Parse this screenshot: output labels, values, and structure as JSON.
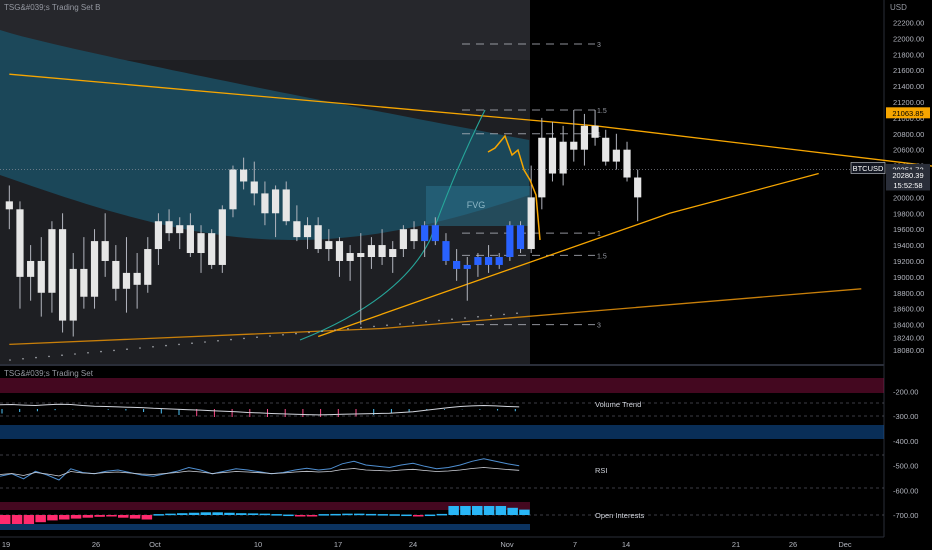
{
  "header": {
    "main_indicator": "TSG&#039;s Trading Set B",
    "sub_indicator": "TSG&#039;s Trading Set",
    "currency": "USD"
  },
  "chart_data": [
    {
      "type": "candlestick",
      "title": "",
      "ylim": [
        18000,
        22500
      ],
      "y_ticks": [
        18080,
        18240,
        18400,
        18600,
        18800,
        19000,
        19200,
        19400,
        19600,
        19800,
        20000,
        20200,
        20400,
        20600,
        20800,
        21000,
        21200,
        21400,
        21600,
        21800,
        22000,
        22200
      ],
      "y_tick_labels": [
        "18080.00",
        "18240.00",
        "18400.00",
        "18600.00",
        "18800.00",
        "19000.00",
        "19200.00",
        "19400.00",
        "19600.00",
        "19800.00",
        "20000.00",
        "20200.00",
        "20400.00",
        "20600.00",
        "20800.00",
        "21000.00",
        "21200.00",
        "21400.00",
        "21600.00",
        "21800.00",
        "22000.00",
        "22200.00"
      ],
      "x_labels": [
        "19",
        "26",
        "Oct",
        "10",
        "17",
        "24",
        "Nov",
        "7",
        "14",
        "21",
        "26",
        "Dec"
      ],
      "grid": false,
      "price_tags": [
        {
          "text": "21063.85",
          "value": 21063.85,
          "color": "#f7a600"
        },
        {
          "text": "BTCUSD",
          "value": 20351.72,
          "color": "#ffffff"
        },
        {
          "text": "20351.72",
          "value": 20351.72,
          "color": "#ffffff"
        },
        {
          "text": "20280.39",
          "value": 20280.39,
          "color": "#ffffff"
        },
        {
          "text": "15:52:58",
          "value": 20200,
          "color": "#ffffff"
        }
      ],
      "level_labels": [
        {
          "text": "3",
          "value": 21930
        },
        {
          "text": "1.5",
          "value": 21100
        },
        {
          "text": "1",
          "value": 20800
        },
        {
          "text": "1",
          "value": 19550
        },
        {
          "text": "1.5",
          "value": 19270
        },
        {
          "text": "3",
          "value": 18400
        }
      ],
      "annotations": [
        "FVG"
      ],
      "candles": [
        [
          19950,
          20150,
          19600,
          19850
        ],
        [
          19850,
          19950,
          18600,
          19000
        ],
        [
          19000,
          19400,
          18700,
          19200
        ],
        [
          19200,
          19500,
          18500,
          18800
        ],
        [
          18800,
          19700,
          18550,
          19600
        ],
        [
          19600,
          19800,
          18300,
          18450
        ],
        [
          18450,
          19300,
          18250,
          19100
        ],
        [
          19100,
          19500,
          18600,
          18750
        ],
        [
          18750,
          19600,
          18600,
          19450
        ],
        [
          19450,
          19800,
          19000,
          19200
        ],
        [
          19200,
          19400,
          18700,
          18850
        ],
        [
          18850,
          19500,
          18550,
          19050
        ],
        [
          19050,
          19300,
          18600,
          18900
        ],
        [
          18900,
          19500,
          18800,
          19350
        ],
        [
          19350,
          19800,
          19150,
          19700
        ],
        [
          19700,
          19850,
          19450,
          19550
        ],
        [
          19550,
          19750,
          19350,
          19650
        ],
        [
          19650,
          19800,
          19250,
          19300
        ],
        [
          19300,
          19650,
          19050,
          19550
        ],
        [
          19550,
          19600,
          19100,
          19150
        ],
        [
          19150,
          19900,
          19050,
          19850
        ],
        [
          19850,
          20400,
          19750,
          20350
        ],
        [
          20350,
          20500,
          20100,
          20200
        ],
        [
          20200,
          20450,
          19900,
          20050
        ],
        [
          20050,
          20200,
          19650,
          19800
        ],
        [
          19800,
          20150,
          19500,
          20100
        ],
        [
          20100,
          20200,
          19650,
          19700
        ],
        [
          19700,
          19900,
          19450,
          19500
        ],
        [
          19500,
          19750,
          19350,
          19650
        ],
        [
          19650,
          19750,
          19300,
          19350
        ],
        [
          19350,
          19600,
          19200,
          19450
        ],
        [
          19450,
          19500,
          19000,
          19200
        ],
        [
          19200,
          19400,
          18950,
          19300
        ],
        [
          19300,
          19550,
          18400,
          19250
        ],
        [
          19250,
          19500,
          19100,
          19400
        ],
        [
          19400,
          19600,
          19150,
          19250
        ],
        [
          19250,
          19450,
          19050,
          19350
        ],
        [
          19350,
          19650,
          19250,
          19600
        ],
        [
          19600,
          19700,
          19350,
          19450
        ],
        [
          19450,
          19700,
          19250,
          19650
        ],
        [
          19650,
          19750,
          19400,
          19450
        ],
        [
          19450,
          19550,
          19150,
          19200
        ],
        [
          19200,
          19350,
          18950,
          19100
        ],
        [
          19100,
          19250,
          18700,
          19150
        ],
        [
          19150,
          19300,
          19000,
          19250
        ],
        [
          19250,
          19400,
          19050,
          19150
        ],
        [
          19150,
          19300,
          19100,
          19250
        ],
        [
          19250,
          19700,
          19200,
          19650
        ],
        [
          19650,
          19700,
          19300,
          19350
        ],
        [
          19350,
          20400,
          19300,
          20000
        ],
        [
          20000,
          21000,
          19850,
          20750
        ],
        [
          20750,
          20950,
          20200,
          20300
        ],
        [
          20300,
          20900,
          20150,
          20700
        ],
        [
          20700,
          21100,
          20450,
          20600
        ],
        [
          20600,
          21050,
          20400,
          20900
        ],
        [
          20900,
          21100,
          20650,
          20750
        ],
        [
          20750,
          20850,
          20400,
          20450
        ],
        [
          20450,
          20800,
          20350,
          20600
        ],
        [
          20600,
          20700,
          20200,
          20250
        ],
        [
          20250,
          20350,
          19700,
          20000
        ]
      ],
      "candle_colors": {
        "up": "#e6e6e6",
        "down": "#2962ff",
        "wick": "#b2b5be"
      },
      "down_candle_indices": [
        39,
        40,
        41,
        42,
        43,
        44,
        45,
        46,
        47,
        48
      ],
      "trendlines": [
        {
          "name": "descending-resistance",
          "color": "#f7a600",
          "points": [
            [
              0,
              21550
            ],
            [
              55,
              20900
            ],
            [
              110,
              20020
            ]
          ]
        },
        {
          "name": "ascending-support",
          "color": "#f7a600",
          "points": [
            [
              29,
              18250
            ],
            [
              62,
              19800
            ],
            [
              76,
              20300
            ]
          ]
        },
        {
          "name": "lower-curve",
          "color": "#c87f0a",
          "points": [
            [
              0,
              18150
            ],
            [
              35,
              18350
            ],
            [
              80,
              18850
            ]
          ]
        }
      ]
    },
    {
      "type": "indicator_panel",
      "y_ticks": [
        -200,
        -300,
        -400,
        -500,
        -600,
        -700
      ],
      "y_tick_labels": [
        "-200.00",
        "-300.00",
        "-400.00",
        "-500.00",
        "-600.00",
        "-700.00"
      ],
      "series": [
        {
          "name": "Volume Trend",
          "values": [
            -250,
            -248,
            -252,
            -255,
            -250,
            -246,
            -248,
            -255,
            -260,
            -262,
            -265,
            -268,
            -270,
            -275,
            -278,
            -282,
            -285,
            -288,
            -292,
            -296,
            -300,
            -305,
            -308,
            -312,
            -315,
            -318,
            -320,
            -322,
            -320,
            -318,
            -316,
            -314,
            -312,
            -310,
            -305,
            -300,
            -290,
            -280,
            -270,
            -262,
            -258,
            -255,
            -258,
            -262,
            -265
          ],
          "bar_values": [
            -280,
            -270,
            -265,
            -258,
            -252,
            -250,
            -255,
            -260,
            -270,
            -280,
            -290,
            -298,
            -305,
            -310,
            -315,
            -318,
            -320,
            -318,
            -315,
            -310,
            -300,
            -290,
            -280,
            -268,
            -260,
            -255,
            -252,
            -255,
            -260,
            -265
          ]
        },
        {
          "name": "RSI",
          "values": [
            -530,
            -520,
            -540,
            -510,
            -525,
            -545,
            -500,
            -515,
            -520,
            -510,
            -505,
            -515,
            -525,
            -530,
            -520,
            -510,
            -495,
            -505,
            -520,
            -510,
            -500,
            -505,
            -512,
            -520,
            -515,
            -505,
            -498,
            -505,
            -500,
            -480,
            -470,
            -485,
            -490,
            -495,
            -485,
            -478,
            -490,
            -500,
            -495,
            -485,
            -470,
            -460,
            -470,
            -480,
            -488
          ]
        },
        {
          "name": "Open Interests",
          "values": [
            -1,
            -1,
            -1,
            -0.8,
            -0.6,
            -0.5,
            -0.4,
            -0.3,
            -0.2,
            -0.15,
            -0.3,
            -0.4,
            -0.5,
            0.1,
            0.15,
            0.2,
            0.25,
            0.3,
            0.3,
            0.25,
            0.2,
            0.18,
            0.15,
            0.1,
            0.05,
            -0.1,
            -0.05,
            0.1,
            0.12,
            0.15,
            0.15,
            0.12,
            0.1,
            0.08,
            0.05,
            -0.05,
            0.05,
            0.12,
            1,
            1,
            1,
            1,
            1,
            0.8,
            0.6
          ]
        }
      ]
    }
  ]
}
